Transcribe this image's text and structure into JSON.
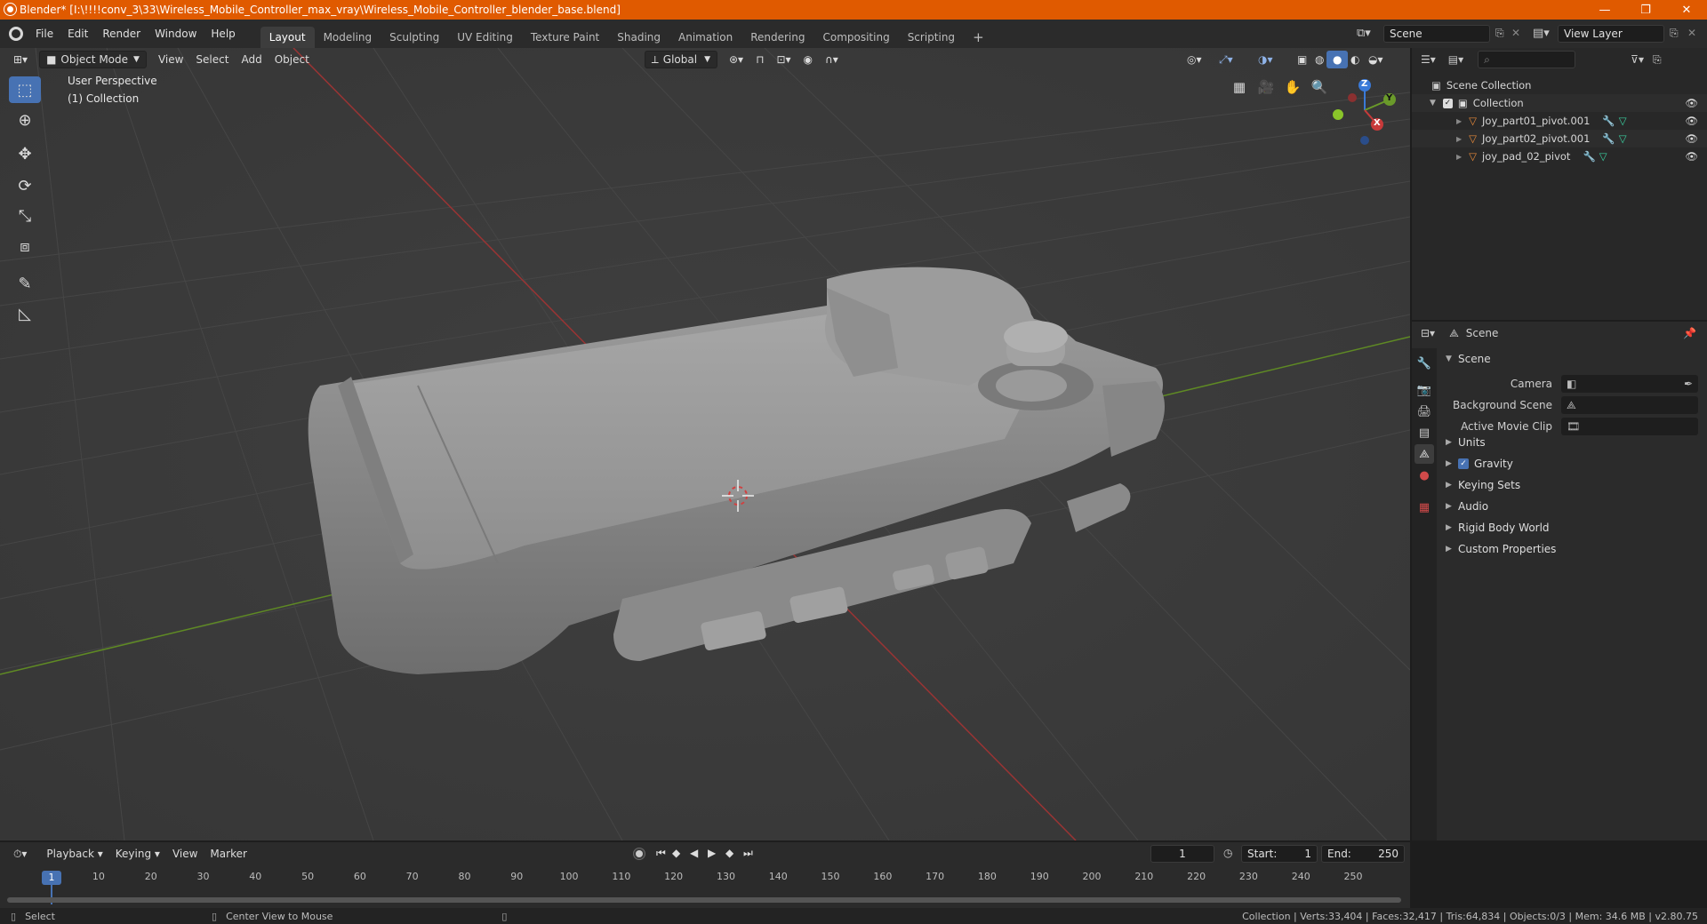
{
  "window": {
    "title": "Blender* [I:\\!!!!conv_3\\33\\Wireless_Mobile_Controller_max_vray\\Wireless_Mobile_Controller_blender_base.blend]",
    "minimize": "—",
    "restore": "❐",
    "close": "✕"
  },
  "menu": {
    "file": "File",
    "edit": "Edit",
    "render": "Render",
    "window": "Window",
    "help": "Help"
  },
  "workspaces": [
    {
      "label": "Layout",
      "active": true
    },
    {
      "label": "Modeling"
    },
    {
      "label": "Sculpting"
    },
    {
      "label": "UV Editing"
    },
    {
      "label": "Texture Paint"
    },
    {
      "label": "Shading"
    },
    {
      "label": "Animation"
    },
    {
      "label": "Rendering"
    },
    {
      "label": "Compositing"
    },
    {
      "label": "Scripting"
    }
  ],
  "add_workspace": "+",
  "scene_selector": {
    "value": "Scene"
  },
  "view_layer_selector": {
    "value": "View Layer"
  },
  "viewport": {
    "mode": "Object Mode",
    "view": "View",
    "select": "Select",
    "add": "Add",
    "object": "Object",
    "orientation": "Global",
    "perspective_label": "User Perspective",
    "collection_label": "(1) Collection",
    "gizmo": {
      "x": "X",
      "y": "Y",
      "z": "Z"
    }
  },
  "outliner": {
    "scene_collection": "Scene Collection",
    "collection": "Collection",
    "items": [
      {
        "name": "Joy_part01_pivot.001"
      },
      {
        "name": "Joy_part02_pivot.001"
      },
      {
        "name": "joy_pad_02_pivot"
      }
    ]
  },
  "properties": {
    "context": "Scene",
    "panel_title": "Scene",
    "camera_label": "Camera",
    "background_scene_label": "Background Scene",
    "active_movie_clip_label": "Active Movie Clip",
    "sections": [
      {
        "label": "Units"
      },
      {
        "label": "Gravity",
        "checkbox": true
      },
      {
        "label": "Keying Sets"
      },
      {
        "label": "Audio"
      },
      {
        "label": "Rigid Body World"
      },
      {
        "label": "Custom Properties"
      }
    ]
  },
  "timeline": {
    "playback": "Playback",
    "keying": "Keying",
    "view": "View",
    "marker": "Marker",
    "current_frame": "1",
    "start_label": "Start:",
    "start": "1",
    "end_label": "End:",
    "end": "250",
    "ticks": [
      "1",
      "10",
      "20",
      "30",
      "40",
      "50",
      "60",
      "70",
      "80",
      "90",
      "100",
      "110",
      "120",
      "130",
      "140",
      "150",
      "160",
      "170",
      "180",
      "190",
      "200",
      "210",
      "220",
      "230",
      "240",
      "250"
    ]
  },
  "status": {
    "select": "Select",
    "center_view": "Center View to Mouse",
    "stats": "Collection | Verts:33,404 | Faces:32,417 | Tris:64,834 | Objects:0/3 | Mem: 34.6 MB | v2.80.75"
  },
  "colors": {
    "accent": "#4772b3",
    "titlebar": "#e05a00",
    "x_axis": "#c73a3a",
    "y_axis": "#6a9a2a",
    "z_axis": "#3a7ad8"
  }
}
